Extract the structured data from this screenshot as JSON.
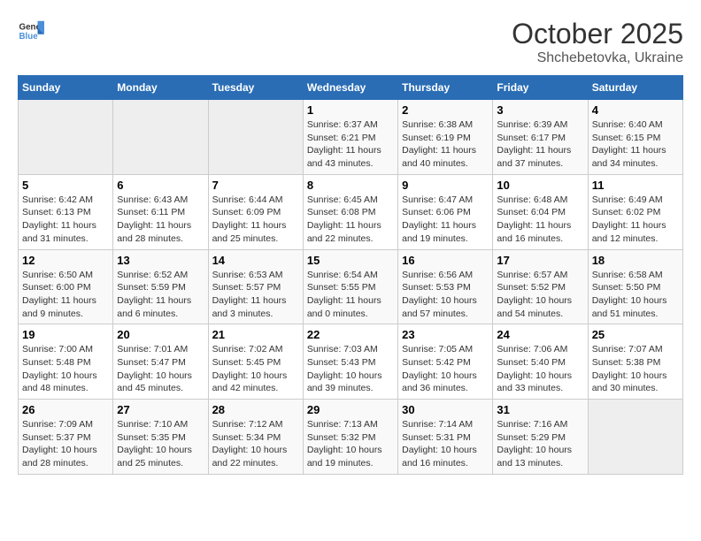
{
  "header": {
    "logo_line1": "General",
    "logo_line2": "Blue",
    "month_year": "October 2025",
    "subtitle": "Shchebetovka, Ukraine"
  },
  "days_of_week": [
    "Sunday",
    "Monday",
    "Tuesday",
    "Wednesday",
    "Thursday",
    "Friday",
    "Saturday"
  ],
  "weeks": [
    [
      {
        "day": "",
        "sunrise": "",
        "sunset": "",
        "daylight": "",
        "empty": true
      },
      {
        "day": "",
        "sunrise": "",
        "sunset": "",
        "daylight": "",
        "empty": true
      },
      {
        "day": "",
        "sunrise": "",
        "sunset": "",
        "daylight": "",
        "empty": true
      },
      {
        "day": "1",
        "sunrise": "Sunrise: 6:37 AM",
        "sunset": "Sunset: 6:21 PM",
        "daylight": "Daylight: 11 hours and 43 minutes."
      },
      {
        "day": "2",
        "sunrise": "Sunrise: 6:38 AM",
        "sunset": "Sunset: 6:19 PM",
        "daylight": "Daylight: 11 hours and 40 minutes."
      },
      {
        "day": "3",
        "sunrise": "Sunrise: 6:39 AM",
        "sunset": "Sunset: 6:17 PM",
        "daylight": "Daylight: 11 hours and 37 minutes."
      },
      {
        "day": "4",
        "sunrise": "Sunrise: 6:40 AM",
        "sunset": "Sunset: 6:15 PM",
        "daylight": "Daylight: 11 hours and 34 minutes."
      }
    ],
    [
      {
        "day": "5",
        "sunrise": "Sunrise: 6:42 AM",
        "sunset": "Sunset: 6:13 PM",
        "daylight": "Daylight: 11 hours and 31 minutes."
      },
      {
        "day": "6",
        "sunrise": "Sunrise: 6:43 AM",
        "sunset": "Sunset: 6:11 PM",
        "daylight": "Daylight: 11 hours and 28 minutes."
      },
      {
        "day": "7",
        "sunrise": "Sunrise: 6:44 AM",
        "sunset": "Sunset: 6:09 PM",
        "daylight": "Daylight: 11 hours and 25 minutes."
      },
      {
        "day": "8",
        "sunrise": "Sunrise: 6:45 AM",
        "sunset": "Sunset: 6:08 PM",
        "daylight": "Daylight: 11 hours and 22 minutes."
      },
      {
        "day": "9",
        "sunrise": "Sunrise: 6:47 AM",
        "sunset": "Sunset: 6:06 PM",
        "daylight": "Daylight: 11 hours and 19 minutes."
      },
      {
        "day": "10",
        "sunrise": "Sunrise: 6:48 AM",
        "sunset": "Sunset: 6:04 PM",
        "daylight": "Daylight: 11 hours and 16 minutes."
      },
      {
        "day": "11",
        "sunrise": "Sunrise: 6:49 AM",
        "sunset": "Sunset: 6:02 PM",
        "daylight": "Daylight: 11 hours and 12 minutes."
      }
    ],
    [
      {
        "day": "12",
        "sunrise": "Sunrise: 6:50 AM",
        "sunset": "Sunset: 6:00 PM",
        "daylight": "Daylight: 11 hours and 9 minutes."
      },
      {
        "day": "13",
        "sunrise": "Sunrise: 6:52 AM",
        "sunset": "Sunset: 5:59 PM",
        "daylight": "Daylight: 11 hours and 6 minutes."
      },
      {
        "day": "14",
        "sunrise": "Sunrise: 6:53 AM",
        "sunset": "Sunset: 5:57 PM",
        "daylight": "Daylight: 11 hours and 3 minutes."
      },
      {
        "day": "15",
        "sunrise": "Sunrise: 6:54 AM",
        "sunset": "Sunset: 5:55 PM",
        "daylight": "Daylight: 11 hours and 0 minutes."
      },
      {
        "day": "16",
        "sunrise": "Sunrise: 6:56 AM",
        "sunset": "Sunset: 5:53 PM",
        "daylight": "Daylight: 10 hours and 57 minutes."
      },
      {
        "day": "17",
        "sunrise": "Sunrise: 6:57 AM",
        "sunset": "Sunset: 5:52 PM",
        "daylight": "Daylight: 10 hours and 54 minutes."
      },
      {
        "day": "18",
        "sunrise": "Sunrise: 6:58 AM",
        "sunset": "Sunset: 5:50 PM",
        "daylight": "Daylight: 10 hours and 51 minutes."
      }
    ],
    [
      {
        "day": "19",
        "sunrise": "Sunrise: 7:00 AM",
        "sunset": "Sunset: 5:48 PM",
        "daylight": "Daylight: 10 hours and 48 minutes."
      },
      {
        "day": "20",
        "sunrise": "Sunrise: 7:01 AM",
        "sunset": "Sunset: 5:47 PM",
        "daylight": "Daylight: 10 hours and 45 minutes."
      },
      {
        "day": "21",
        "sunrise": "Sunrise: 7:02 AM",
        "sunset": "Sunset: 5:45 PM",
        "daylight": "Daylight: 10 hours and 42 minutes."
      },
      {
        "day": "22",
        "sunrise": "Sunrise: 7:03 AM",
        "sunset": "Sunset: 5:43 PM",
        "daylight": "Daylight: 10 hours and 39 minutes."
      },
      {
        "day": "23",
        "sunrise": "Sunrise: 7:05 AM",
        "sunset": "Sunset: 5:42 PM",
        "daylight": "Daylight: 10 hours and 36 minutes."
      },
      {
        "day": "24",
        "sunrise": "Sunrise: 7:06 AM",
        "sunset": "Sunset: 5:40 PM",
        "daylight": "Daylight: 10 hours and 33 minutes."
      },
      {
        "day": "25",
        "sunrise": "Sunrise: 7:07 AM",
        "sunset": "Sunset: 5:38 PM",
        "daylight": "Daylight: 10 hours and 30 minutes."
      }
    ],
    [
      {
        "day": "26",
        "sunrise": "Sunrise: 7:09 AM",
        "sunset": "Sunset: 5:37 PM",
        "daylight": "Daylight: 10 hours and 28 minutes."
      },
      {
        "day": "27",
        "sunrise": "Sunrise: 7:10 AM",
        "sunset": "Sunset: 5:35 PM",
        "daylight": "Daylight: 10 hours and 25 minutes."
      },
      {
        "day": "28",
        "sunrise": "Sunrise: 7:12 AM",
        "sunset": "Sunset: 5:34 PM",
        "daylight": "Daylight: 10 hours and 22 minutes."
      },
      {
        "day": "29",
        "sunrise": "Sunrise: 7:13 AM",
        "sunset": "Sunset: 5:32 PM",
        "daylight": "Daylight: 10 hours and 19 minutes."
      },
      {
        "day": "30",
        "sunrise": "Sunrise: 7:14 AM",
        "sunset": "Sunset: 5:31 PM",
        "daylight": "Daylight: 10 hours and 16 minutes."
      },
      {
        "day": "31",
        "sunrise": "Sunrise: 7:16 AM",
        "sunset": "Sunset: 5:29 PM",
        "daylight": "Daylight: 10 hours and 13 minutes."
      },
      {
        "day": "",
        "sunrise": "",
        "sunset": "",
        "daylight": "",
        "empty": true
      }
    ]
  ]
}
